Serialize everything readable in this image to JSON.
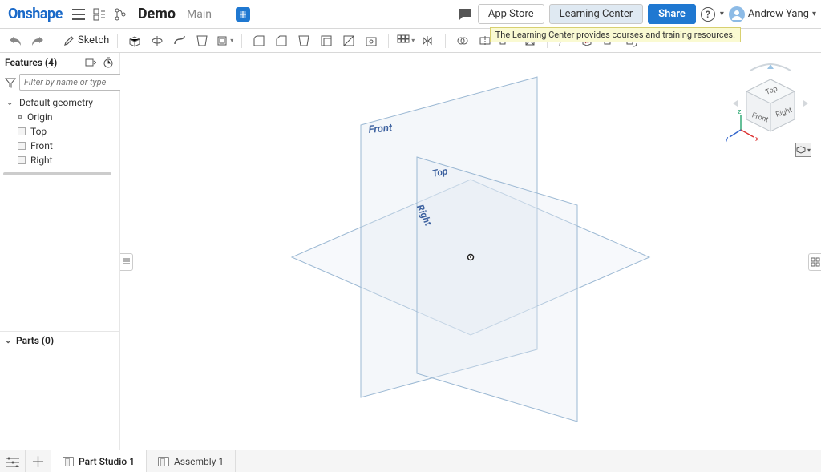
{
  "app": {
    "logo": "Onshape",
    "doc_title": "Demo",
    "workspace": "Main"
  },
  "header_buttons": {
    "app_store": "App Store",
    "learning_center": "Learning Center",
    "share": "Share"
  },
  "user": {
    "name": "Andrew Yang"
  },
  "tooltip": {
    "learning_center": "The Learning Center provides courses and training resources."
  },
  "toolbar": {
    "sketch_label": "Sketch"
  },
  "features": {
    "header": "Features (4)",
    "filter_placeholder": "Filter by name or type",
    "root": "Default geometry",
    "items": [
      {
        "label": "Origin",
        "icon": "origin"
      },
      {
        "label": "Top",
        "icon": "plane"
      },
      {
        "label": "Front",
        "icon": "plane"
      },
      {
        "label": "Right",
        "icon": "plane"
      }
    ]
  },
  "parts": {
    "header": "Parts (0)"
  },
  "viewport": {
    "plane_labels": {
      "front": "Front",
      "top": "Top",
      "right": "Right"
    },
    "cube": {
      "top": "Top",
      "front": "Front",
      "right": "Right"
    },
    "axes": {
      "x": "x",
      "y": "y",
      "z": "z"
    }
  },
  "tabs": {
    "part_studio": "Part Studio 1",
    "assembly": "Assembly 1"
  }
}
